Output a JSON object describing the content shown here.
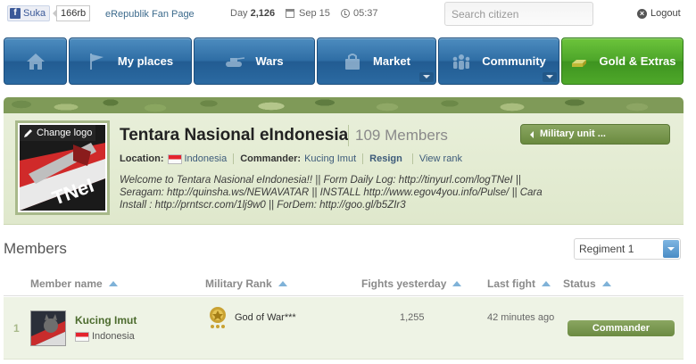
{
  "topbar": {
    "fb_like_label": "Suka",
    "fb_like_count": "166rb",
    "fan_page": "eRepublik Fan Page",
    "day_label": "Day",
    "day_value": "2,126",
    "date": "Sep 15",
    "time": "05:37",
    "search_placeholder": "Search citizen",
    "logout": "Logout"
  },
  "nav": {
    "items": [
      {
        "label": "",
        "icon": "home-icon"
      },
      {
        "label": "My places",
        "icon": "flag-icon"
      },
      {
        "label": "Wars",
        "icon": "tank-icon"
      },
      {
        "label": "Market",
        "icon": "bag-icon"
      },
      {
        "label": "Community",
        "icon": "people-icon"
      },
      {
        "label": "Gold & Extras",
        "icon": "gold-icon"
      }
    ]
  },
  "unit": {
    "change_logo": "Change logo",
    "title": "Tentara Nasional eIndonesia",
    "members_count": "109 Members",
    "military_unit_button": "Military unit ...",
    "location_label": "Location:",
    "location_value": "Indonesia",
    "commander_label": "Commander:",
    "commander_value": "Kucing Imut",
    "resign": "Resign",
    "view_rank": "View rank",
    "description_lines": [
      "Welcome to Tentara Nasional eIndonesia!! || Form Daily Log: http://tinyurl.com/logTNeI ||",
      "Seragam: http://quinsha.ws/NEWAVATAR || INSTALL http://www.egov4you.info/Pulse/ || Cara",
      "Install : http://prntscr.com/1lj9w0 || ForDem: http://goo.gl/b5ZIr3"
    ]
  },
  "members": {
    "heading": "Members",
    "regiment": "Regiment 1",
    "columns": {
      "name": "Member name",
      "rank": "Military Rank",
      "fights": "Fights yesterday",
      "last_fight": "Last fight",
      "status": "Status"
    },
    "rows": [
      {
        "index": "1",
        "name": "Kucing Imut",
        "country": "Indonesia",
        "rank": "God of War***",
        "fights": "1,255",
        "last_fight": "42 minutes ago",
        "status": "Commander"
      }
    ]
  },
  "colors": {
    "nav_blue": "#2f6ea5",
    "nav_green": "#4ea62a",
    "panel_green": "#e8efd9",
    "badge_green": "#7a9a52"
  }
}
